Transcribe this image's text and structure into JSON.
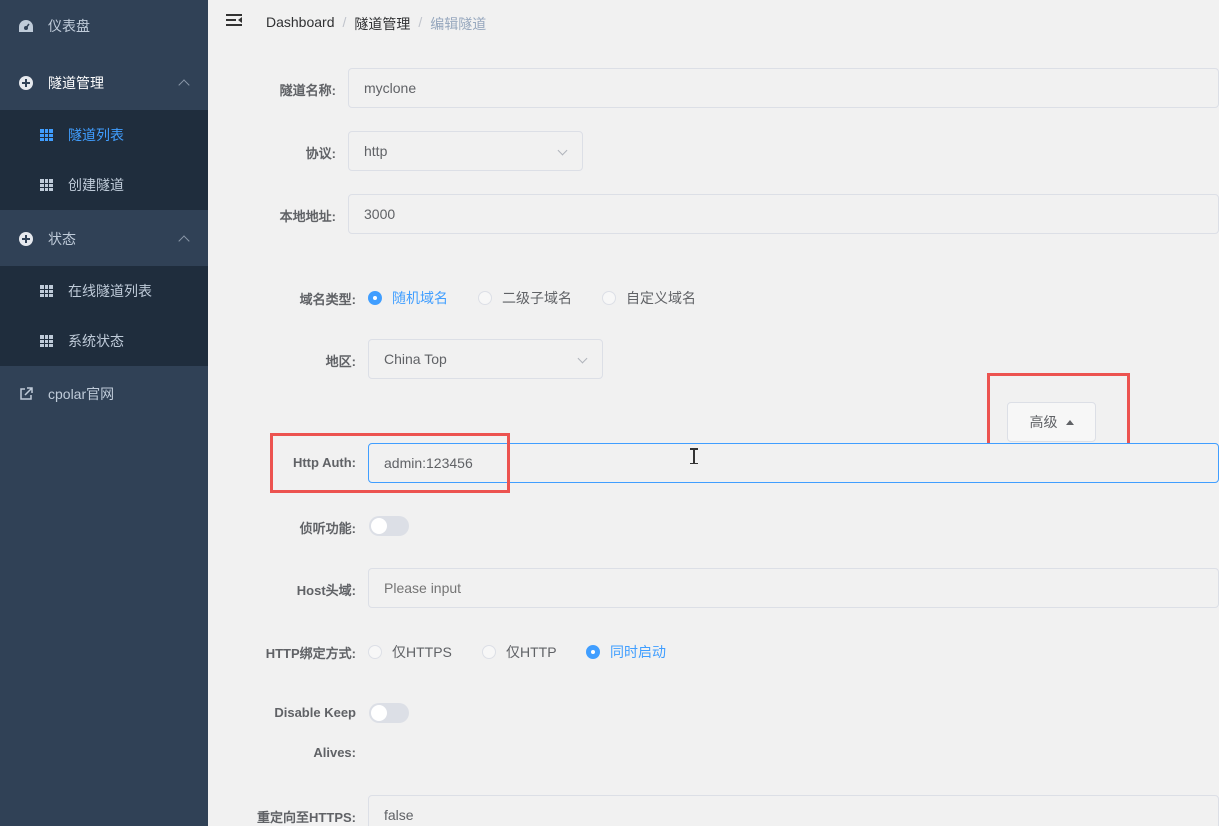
{
  "sidebar": {
    "items": [
      {
        "label": "仪表盘",
        "icon": "dashboard-icon"
      },
      {
        "label": "隧道管理",
        "icon": "circle-plus-icon"
      },
      {
        "label": "隧道列表",
        "icon": "grid-icon"
      },
      {
        "label": "创建隧道",
        "icon": "grid-icon"
      },
      {
        "label": "状态",
        "icon": "circle-plus-icon"
      },
      {
        "label": "在线隧道列表",
        "icon": "grid-icon"
      },
      {
        "label": "系统状态",
        "icon": "grid-icon"
      },
      {
        "label": "cpolar官网",
        "icon": "external-link-icon"
      }
    ]
  },
  "header": {
    "breadcrumb": [
      "Dashboard",
      "隧道管理",
      "编辑隧道"
    ],
    "separator": "/"
  },
  "form": {
    "tunnel_name": {
      "label": "隧道名称:",
      "value": "myclone"
    },
    "protocol": {
      "label": "协议:",
      "value": "http"
    },
    "local_address": {
      "label": "本地地址:",
      "value": "3000"
    },
    "domain_type": {
      "label": "域名类型:",
      "options": [
        "随机域名",
        "二级子域名",
        "自定义域名"
      ],
      "selected": "随机域名"
    },
    "region": {
      "label": "地区:",
      "value": "China Top"
    },
    "advanced_button": "高级",
    "http_auth": {
      "label": "Http Auth:",
      "value": "admin:123456"
    },
    "inspect": {
      "label": "侦听功能:"
    },
    "host_header": {
      "label": "Host头域:",
      "placeholder": "Please input"
    },
    "bind_tls": {
      "label": "HTTP绑定方式:",
      "options": [
        "仅HTTPS",
        "仅HTTP",
        "同时启动"
      ],
      "selected": "同时启动"
    },
    "disable_keep_alives": {
      "label_line1": "Disable Keep",
      "label_line2": "Alives:"
    },
    "redirect_https": {
      "label": "重定向至HTTPS:",
      "value": "false"
    }
  },
  "colors": {
    "sidebar_bg": "#304156",
    "accent": "#409eff",
    "highlight": "#ec5350"
  }
}
